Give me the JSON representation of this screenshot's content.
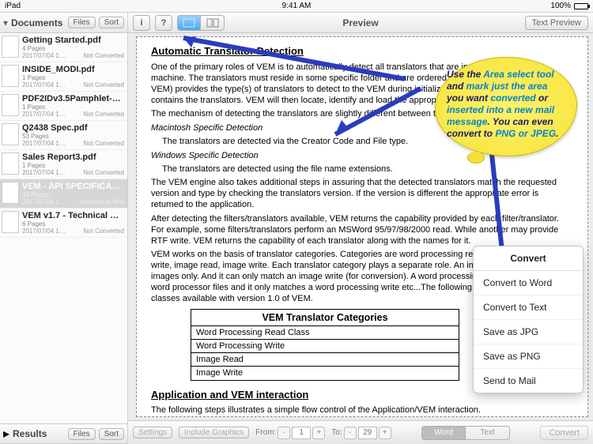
{
  "statusbar": {
    "device": "iPad",
    "time": "9:41 AM",
    "battery": "100%"
  },
  "sidebar": {
    "header": {
      "title": "Documents",
      "files_btn": "Files",
      "sort_btn": "Sort"
    },
    "results": {
      "title": "Results",
      "files_btn": "Files",
      "sort_btn": "Sort"
    },
    "docs": [
      {
        "name": "Getting Started.pdf",
        "pages": "4 Pages",
        "date": "2017/07/04 1…",
        "status": "Not Converted"
      },
      {
        "name": "INSIDE_MODI.pdf",
        "pages": "1 Pages",
        "date": "2017/07/04 1…",
        "status": "Not Converted"
      },
      {
        "name": "PDF2IDv3.5Pamphlet-3.…",
        "pages": "1 Pages",
        "date": "2017/07/04 1…",
        "status": "Not Converted"
      },
      {
        "name": "Q2438 Spec.pdf",
        "pages": "53 Pages",
        "date": "2017/07/04 1…",
        "status": "Not Converted"
      },
      {
        "name": "Sales Report3.pdf",
        "pages": "1 Pages",
        "date": "2017/07/04 1…",
        "status": "Not Converted"
      },
      {
        "name": "VEM - API SPECIFICATI…",
        "pages": "29 Pages",
        "date": "2017/07/04 1…",
        "status": "onverted to Wor"
      },
      {
        "name": "VEM v1.7 - Technical S…",
        "pages": "6 Pages",
        "date": "2017/07/04 1…",
        "status": "Not Converted"
      }
    ]
  },
  "main": {
    "title": "Preview",
    "text_preview_btn": "Text Preview",
    "settings_btn": "Settings",
    "include_graphics": "Include Graphics",
    "from_label": "From:",
    "to_label": "To:",
    "from_val": "1",
    "to_val": "29",
    "seg_word": "Word",
    "seg_text": "Text",
    "convert_btn": "Convert"
  },
  "doc": {
    "h1": "Automatic Translator Detection",
    "p1": "One of the primary roles of VEM is to automatically detect all translators that are installed on the target machine. The translators must reside in some specific folder and are ordered. The application (which uses VEM) provides the type(s) of translators to detect to the VEM during initialization and each folder that contains the translators. VEM will then locate, identify and load the appropriate translators.",
    "p2": "The mechanism of detecting the translators are slightly different between the Macintosh and Windows kits.",
    "em1": "Macintosh Specific Detection",
    "p3": "The translators are detected via the Creator Code and File type.",
    "em2": "Windows Specific Detection",
    "p4": "The translators are detected using the file name extensions.",
    "p5": "The VEM engine also takes additional steps in assuring that the detected translators match the requested version and type by checking the translators version. If the version is different the appropriate error is returned to the application.",
    "p6": "After detecting the filters/translators available, VEM returns the capability provided by each filter/translator. For example, some filters/translators perform an MSWord 95/97/98/2000 read. While another may provide RTF write. VEM returns the capability of each translator along with the names for it.",
    "p7": "VEM works on the basis of translator categories. Categories are word processing read, word processing write, image read, image write. Each translator category plays a separate role. An image read can read images only. And it can only match an image write (for conversion). A word processing read can only read word processor files and it only matches a word processing write etc...The following table lists the translator classes available with version 1.0 of VEM.",
    "table_title": "VEM Translator Categories",
    "rows": [
      "Word Processing Read Class",
      "Word Processing Write",
      "Image Read",
      "Image Write"
    ],
    "h2": "Application and VEM interaction",
    "p8": "The following steps illustrates a simple flow control of the Application/VEM interaction."
  },
  "bubble": {
    "t1": "Use the ",
    "t1b": "Area select tool",
    "t2": " and ",
    "t2b": "mark just the area",
    "t3": " you want ",
    "t3b": "converted",
    "t4": " or ",
    "t4b": "inserted into a new mail message",
    "t5": ". You can even convert to ",
    "t5b": "PNG or JPEG",
    "t6": "."
  },
  "menu": {
    "title": "Convert",
    "items": [
      "Convert to Word",
      "Convert to Text",
      "Save as JPG",
      "Save as PNG",
      "Send to Mail"
    ]
  }
}
